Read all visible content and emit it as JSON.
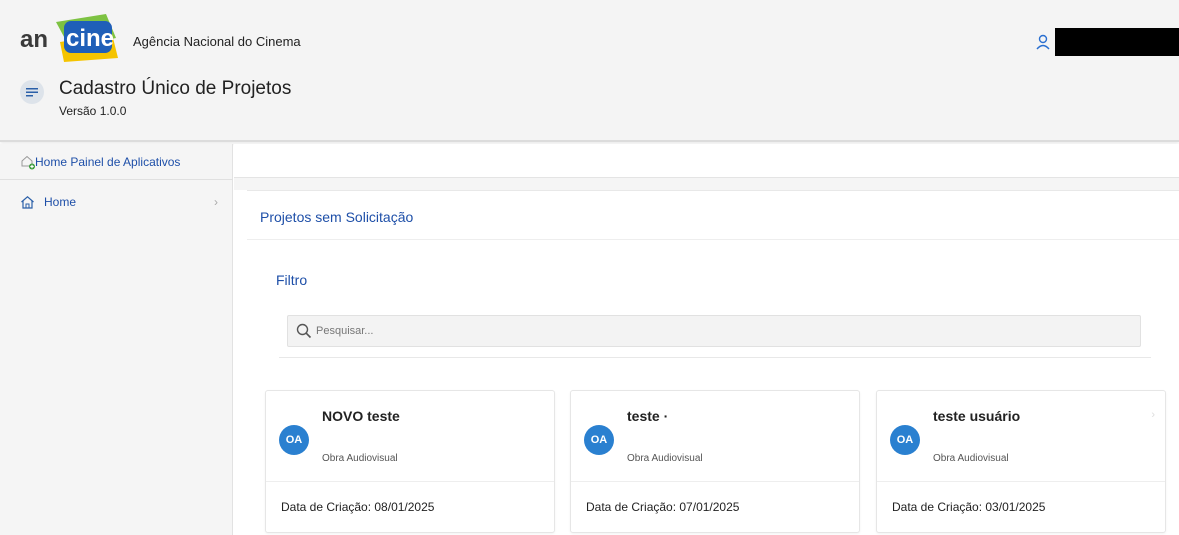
{
  "header": {
    "logo_text": "ancine",
    "org_name": "Agência Nacional do Cinema",
    "app_title": "Cadastro Único de Projetos",
    "app_version": "Versão 1.0.0"
  },
  "sidebar": {
    "items": [
      {
        "label": "Home Painel de Aplicativos",
        "icon": "home-apps-icon"
      },
      {
        "label": "Home",
        "icon": "home-icon"
      }
    ]
  },
  "main": {
    "section_title": "Projetos sem Solicitação",
    "filter_title": "Filtro",
    "search": {
      "placeholder": "Pesquisar...",
      "value": ""
    },
    "cards": [
      {
        "avatar": "OA",
        "title": "NOVO teste",
        "subtitle": "Obra Audiovisual",
        "date": "Data de Criação: 08/01/2025"
      },
      {
        "avatar": "OA",
        "title": "teste ·",
        "subtitle": "Obra Audiovisual",
        "date": "Data de Criação: 07/01/2025"
      },
      {
        "avatar": "OA",
        "title": "teste usuário",
        "subtitle": "Obra Audiovisual",
        "date": "Data de Criação: 03/01/2025"
      }
    ]
  },
  "colors": {
    "link_blue": "#1e4fa8",
    "avatar_blue": "#2a80d0",
    "logo_blue": "#1f5fb8",
    "logo_green": "#7dc242",
    "logo_yellow": "#f5c400"
  }
}
